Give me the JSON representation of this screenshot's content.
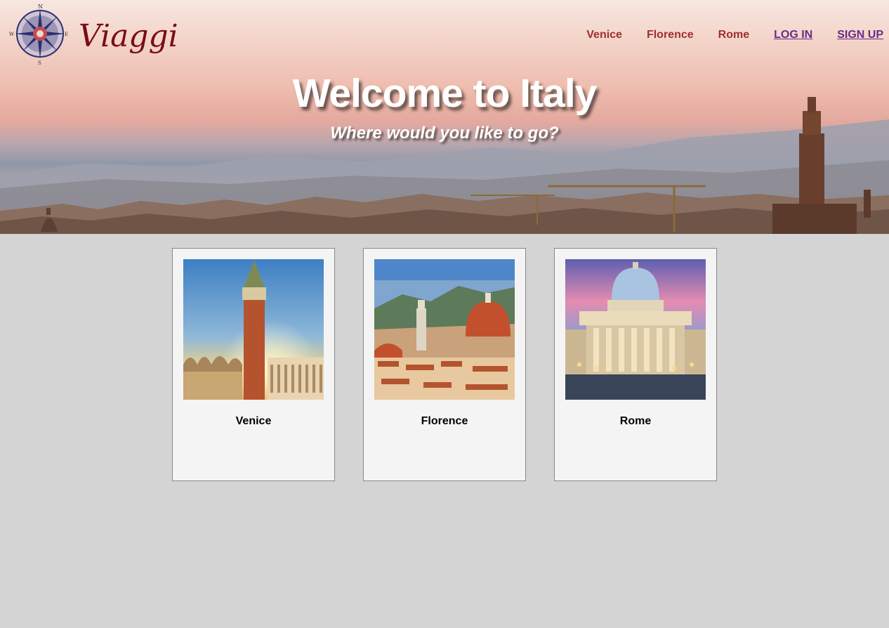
{
  "brand": {
    "name": "Viaggi",
    "compass": [
      "N",
      "E",
      "S",
      "W"
    ]
  },
  "nav": {
    "items": [
      {
        "label": "Venice"
      },
      {
        "label": "Florence"
      },
      {
        "label": "Rome"
      }
    ],
    "login_label": "LOG IN",
    "signup_label": "SIGN UP"
  },
  "hero": {
    "title": "Welcome to Italy",
    "subtitle": "Where would you like to go?"
  },
  "cards": [
    {
      "name": "Venice"
    },
    {
      "name": "Florence"
    },
    {
      "name": "Rome"
    }
  ],
  "colors": {
    "nav_city": "#a02f2f",
    "nav_auth": "#6b2a8a",
    "brand_text": "#7a0d12",
    "page_bg": "#d4d4d4",
    "card_bg": "#f4f4f4"
  }
}
